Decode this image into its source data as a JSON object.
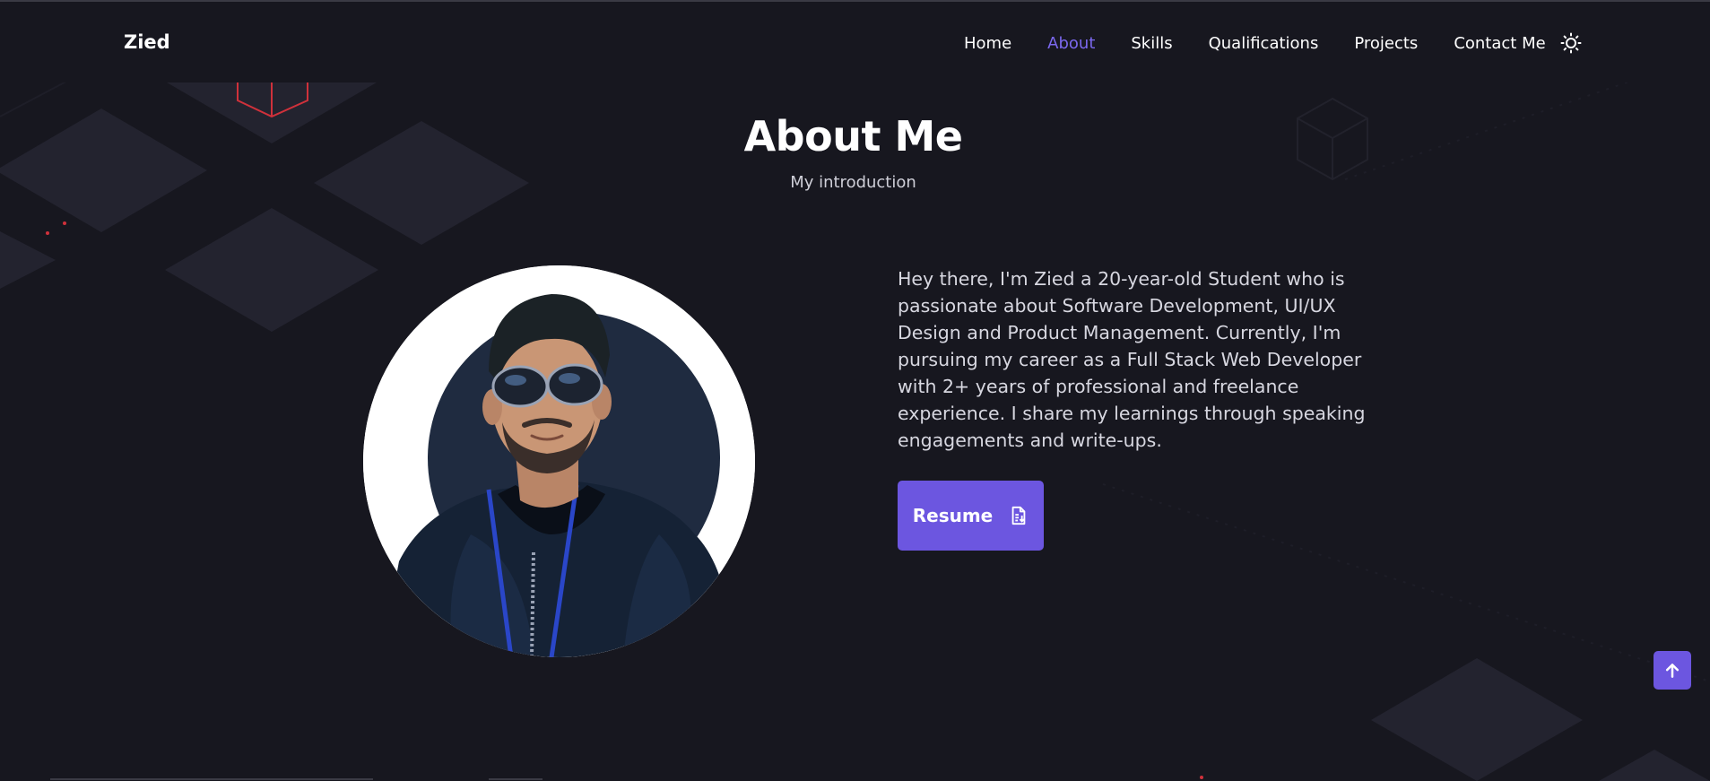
{
  "brand": {
    "name": "Zied"
  },
  "nav": {
    "items": [
      {
        "label": "Home"
      },
      {
        "label": "About"
      },
      {
        "label": "Skills"
      },
      {
        "label": "Qualifications"
      },
      {
        "label": "Projects"
      },
      {
        "label": "Contact Me"
      }
    ],
    "active": "About",
    "theme_icon": "sun-icon"
  },
  "about": {
    "title": "About Me",
    "subtitle": "My introduction",
    "description": "Hey there, I'm Zied a 20-year-old Student who is passionate about Software Development, UI/UX Design and Product Management. Currently, I'm pursuing my career as a Full Stack Web Developer with 2+ years of professional and freelance experience. I share my learnings through speaking engagements and write-ups.",
    "resume_label": "Resume",
    "resume_icon": "document-download-icon",
    "photo_icon": "profile-photo"
  },
  "scroll_top": {
    "icon": "arrow-up-icon"
  },
  "colors": {
    "background": "#17171f",
    "accent": "#6c56e0",
    "active_link": "#7b68ee",
    "text": "#d7d7e0"
  }
}
